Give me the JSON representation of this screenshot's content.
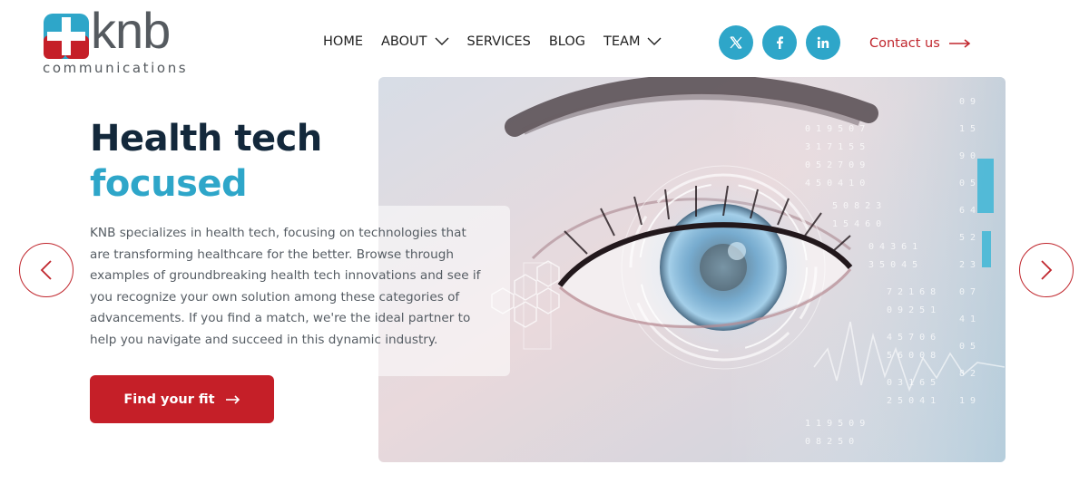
{
  "brand": {
    "name": "knb",
    "tagline": "communications",
    "colors": {
      "accent_red": "#c51f28",
      "accent_blue": "#2ea6c9",
      "logo_gray": "#555a5f"
    }
  },
  "nav": {
    "items": [
      {
        "label": "HOME",
        "has_dropdown": false
      },
      {
        "label": "ABOUT",
        "has_dropdown": true
      },
      {
        "label": "SERVICES",
        "has_dropdown": false
      },
      {
        "label": "BLOG",
        "has_dropdown": false
      },
      {
        "label": "TEAM",
        "has_dropdown": true
      }
    ]
  },
  "socials": [
    {
      "icon": "x-twitter-icon"
    },
    {
      "icon": "facebook-icon"
    },
    {
      "icon": "linkedin-icon"
    }
  ],
  "contact": {
    "label": "Contact us"
  },
  "hero": {
    "title_line1": "Health tech",
    "title_line2": "focused",
    "description": "KNB specializes in health tech, focusing on technologies that are transforming healthcare for the better. Browse through examples of groundbreaking health tech innovations and see if you recognize your own solution among these categories of advancements. If you find a match, we're the ideal partner to help you navigate and succeed in this dynamic industry.",
    "cta_label": "Find your fit",
    "image": "eye-scan-digital-image"
  },
  "carousel": {
    "prev_icon": "chevron-left-icon",
    "next_icon": "chevron-right-icon"
  }
}
